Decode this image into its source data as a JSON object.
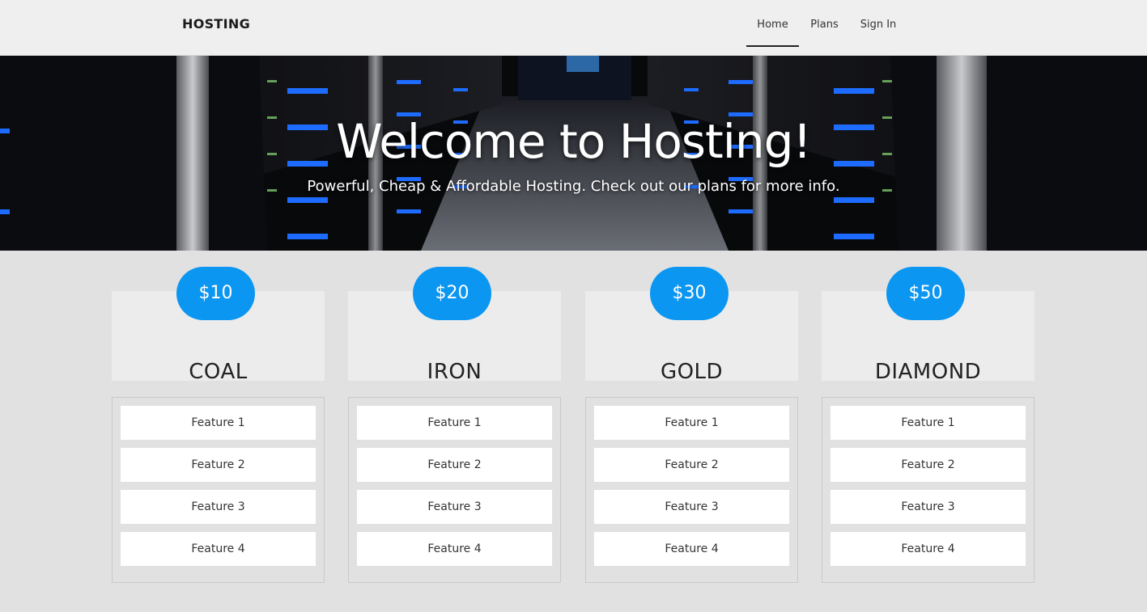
{
  "navbar": {
    "brand": "HOSTING",
    "links": [
      "Home",
      "Plans",
      "Sign In"
    ],
    "active": "Home"
  },
  "hero": {
    "title": "Welcome to Hosting!",
    "subtitle": "Powerful, Cheap & Affordable Hosting. Check out our plans for more info."
  },
  "plans": [
    {
      "price": "$10",
      "name": "COAL",
      "features": [
        "Feature 1",
        "Feature 2",
        "Feature 3",
        "Feature 4"
      ]
    },
    {
      "price": "$20",
      "name": "IRON",
      "features": [
        "Feature 1",
        "Feature 2",
        "Feature 3",
        "Feature 4"
      ]
    },
    {
      "price": "$30",
      "name": "GOLD",
      "features": [
        "Feature 1",
        "Feature 2",
        "Feature 3",
        "Feature 4"
      ]
    },
    {
      "price": "$50",
      "name": "DIAMOND",
      "features": [
        "Feature 1",
        "Feature 2",
        "Feature 3",
        "Feature 4"
      ]
    }
  ],
  "colors": {
    "accent": "#0b96f2",
    "page_bg": "#e1e1e1",
    "navbar_bg": "#efefef",
    "card_head_bg": "#ececec",
    "server_light": "#1e6cff"
  }
}
